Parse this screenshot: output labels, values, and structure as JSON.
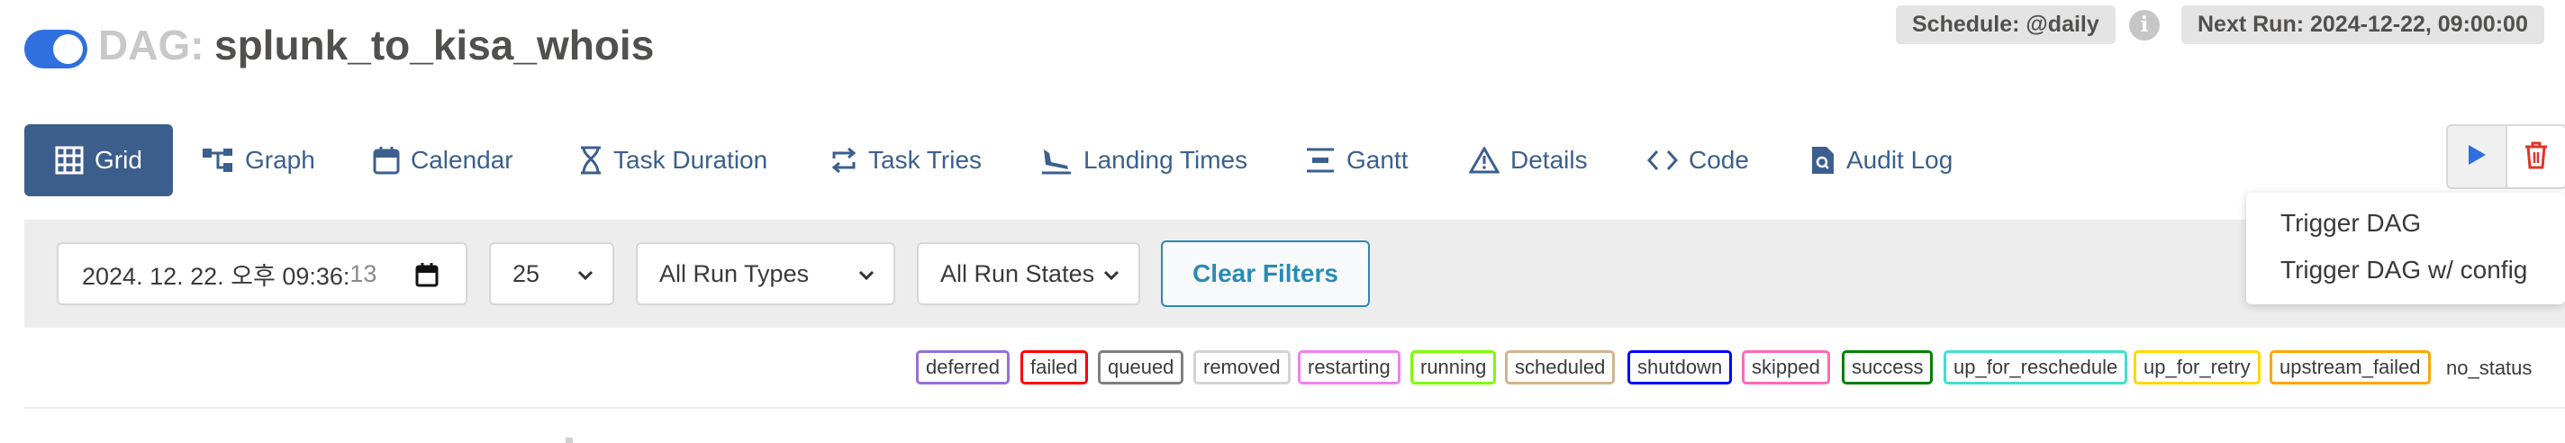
{
  "header": {
    "toggle_on": true,
    "dag_prefix": "DAG:",
    "dag_name": "splunk_to_kisa_whois",
    "schedule": "Schedule: @daily",
    "next_run": "Next Run: 2024-12-22, 09:00:00",
    "info_icon": "info-icon"
  },
  "tabs": [
    {
      "label": "Grid",
      "icon": "grid-icon",
      "active": true
    },
    {
      "label": "Graph",
      "icon": "graph-icon"
    },
    {
      "label": "Calendar",
      "icon": "calendar-icon"
    },
    {
      "label": "Task Duration",
      "icon": "hourglass-icon"
    },
    {
      "label": "Task Tries",
      "icon": "retry-icon"
    },
    {
      "label": "Landing Times",
      "icon": "plane-landing-icon"
    },
    {
      "label": "Gantt",
      "icon": "gantt-icon"
    },
    {
      "label": "Details",
      "icon": "warning-triangle-icon"
    },
    {
      "label": "Code",
      "icon": "code-icon"
    },
    {
      "label": "Audit Log",
      "icon": "file-search-icon"
    }
  ],
  "actions": {
    "trigger_icon": "play-icon",
    "delete_icon": "trash-icon",
    "trigger_menu": [
      "Trigger DAG",
      "Trigger DAG w/ config"
    ]
  },
  "filters": {
    "datetime_value": "2024. 12. 22. 오후 09:36:",
    "datetime_seconds": "13",
    "num_runs": "25",
    "run_types": "All Run Types",
    "run_states": "All Run States",
    "clear_label": "Clear Filters"
  },
  "legend": [
    {
      "label": "deferred",
      "color": "#9370db"
    },
    {
      "label": "failed",
      "color": "#ff0000"
    },
    {
      "label": "queued",
      "color": "#808080"
    },
    {
      "label": "removed",
      "color": "#d3d3d3"
    },
    {
      "label": "restarting",
      "color": "#ee82ee"
    },
    {
      "label": "running",
      "color": "#7cfc00"
    },
    {
      "label": "scheduled",
      "color": "#d2b48c"
    },
    {
      "label": "shutdown",
      "color": "#0000ff"
    },
    {
      "label": "skipped",
      "color": "#ff69b4"
    },
    {
      "label": "success",
      "color": "#008000"
    },
    {
      "label": "up_for_reschedule",
      "color": "#40e0d0"
    },
    {
      "label": "up_for_retry",
      "color": "#ffd700"
    },
    {
      "label": "upstream_failed",
      "color": "#ffa500"
    }
  ],
  "no_status_label": "no_status"
}
